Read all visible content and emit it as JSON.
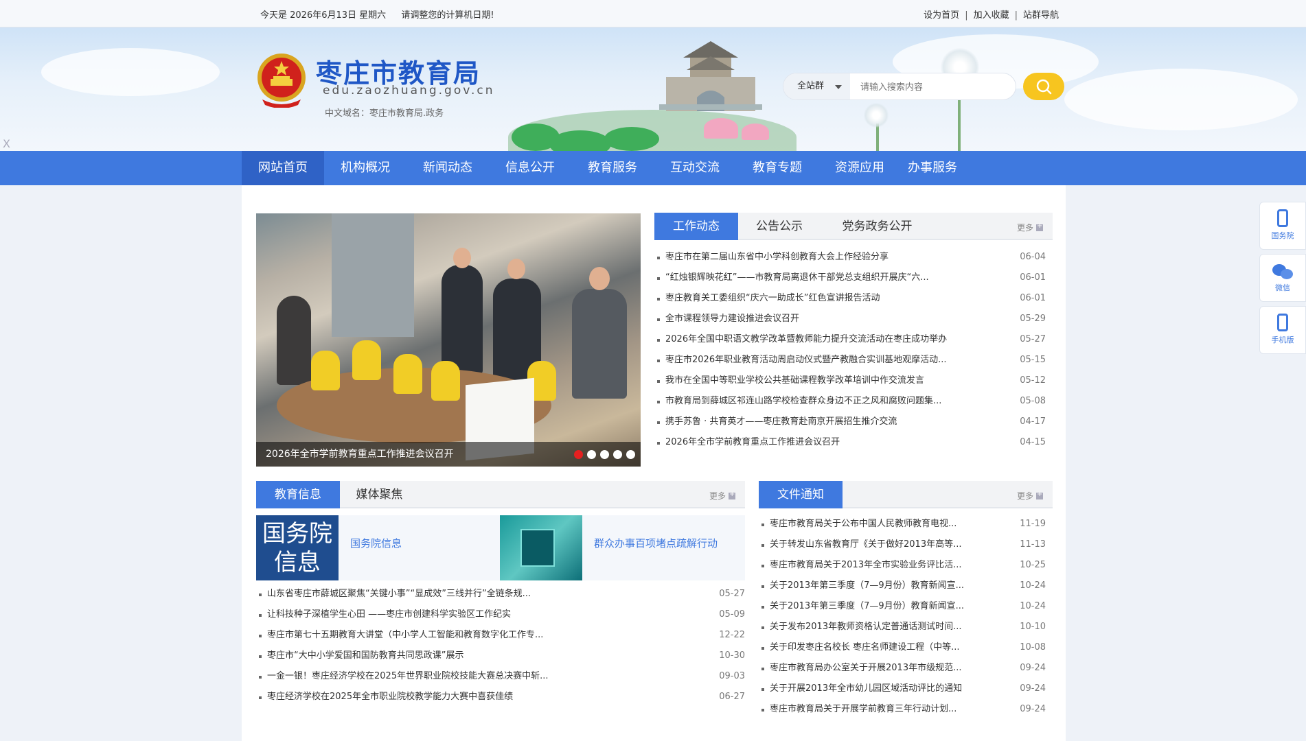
{
  "topbar": {
    "date_text": "今天是 2026年6月13日 星期六",
    "notice": "请调整您的计算机日期!",
    "links": [
      "设为首页",
      "加入收藏",
      "站群导航"
    ],
    "separator": "|"
  },
  "header": {
    "title": "枣庄市教育局",
    "domain": "edu.zaozhuang.gov.cn",
    "cn_domain": "中文域名：枣庄市教育局.政务",
    "close_mark": "X"
  },
  "search": {
    "scope": "全站群",
    "placeholder": "请输入搜索内容"
  },
  "nav": {
    "items": [
      "网站首页",
      "机构概况",
      "新闻动态",
      "信息公开",
      "教育服务",
      "互动交流",
      "教育专题",
      "资源应用",
      "办事服务"
    ],
    "active_index": 0
  },
  "slider": {
    "caption": "2026年全市学前教育重点工作推进会议召开",
    "dot_count": 5,
    "active_dot": 0
  },
  "work_box": {
    "tabs": [
      "工作动态",
      "公告公示",
      "党务政务公开"
    ],
    "more": "更多",
    "items": [
      {
        "title": "枣庄市在第二届山东省中小学科创教育大会上作经验分享",
        "date": "06-04"
      },
      {
        "title": "“红烛银辉映花红”——市教育局离退休干部党总支组织开展庆“六...",
        "date": "06-01"
      },
      {
        "title": "枣庄教育关工委组织“庆六一助成长”红色宣讲报告活动",
        "date": "06-01"
      },
      {
        "title": "全市课程领导力建设推进会议召开",
        "date": "05-29"
      },
      {
        "title": "2026年全国中职语文教学改革暨教师能力提升交流活动在枣庄成功举办",
        "date": "05-27"
      },
      {
        "title": "枣庄市2026年职业教育活动周启动仪式暨产教融合实训基地观摩活动...",
        "date": "05-15"
      },
      {
        "title": "我市在全国中等职业学校公共基础课程教学改革培训中作交流发言",
        "date": "05-12"
      },
      {
        "title": "市教育局到薛城区祁连山路学校检查群众身边不正之风和腐败问题集...",
        "date": "05-08"
      },
      {
        "title": "携手苏鲁 · 共育英才——枣庄教育赴南京开展招生推介交流",
        "date": "04-17"
      },
      {
        "title": "2026年全市学前教育重点工作推进会议召开",
        "date": "04-15"
      }
    ]
  },
  "edu_box": {
    "tabs": [
      "教育信息",
      "媒体聚焦"
    ],
    "more": "更多",
    "promos": [
      {
        "image_text_line1": "国务院",
        "image_text_line2": "信息",
        "label": "国务院信息"
      },
      {
        "label": "群众办事百项堵点疏解行动"
      }
    ],
    "items": [
      {
        "title": "山东省枣庄市薛城区聚焦“关键小事”“显成效”三线并行”全链条规...",
        "date": "05-27"
      },
      {
        "title": "让科技种子深植学生心田 ——枣庄市创建科学实验区工作纪实",
        "date": "05-09"
      },
      {
        "title": "枣庄市第七十五期教育大讲堂（中小学人工智能和教育数字化工作专...",
        "date": "12-22"
      },
      {
        "title": "枣庄市“大中小学爱国和国防教育共同思政课”展示",
        "date": "10-30"
      },
      {
        "title": "一金一银！枣庄经济学校在2025年世界职业院校技能大赛总决赛中斩...",
        "date": "09-03"
      },
      {
        "title": "枣庄经济学校在2025年全市职业院校教学能力大赛中喜获佳绩",
        "date": "06-27"
      }
    ]
  },
  "doc_box": {
    "tabs": [
      "文件通知"
    ],
    "more": "更多",
    "items": [
      {
        "title": "枣庄市教育局关于公布中国人民教师教育电视...",
        "date": "11-19"
      },
      {
        "title": "关于转发山东省教育厅《关于做好2013年高等...",
        "date": "11-13"
      },
      {
        "title": "枣庄市教育局关于2013年全市实验业务评比活...",
        "date": "10-25"
      },
      {
        "title": "关于2013年第三季度（7—9月份）教育新闻宣...",
        "date": "10-24"
      },
      {
        "title": "关于2013年第三季度（7—9月份）教育新闻宣...",
        "date": "10-24"
      },
      {
        "title": "关于发布2013年教师资格认定普通话测试时间...",
        "date": "10-10"
      },
      {
        "title": "关于印发枣庄名校长 枣庄名师建设工程（中等...",
        "date": "10-08"
      },
      {
        "title": "枣庄市教育局办公室关于开展2013年市级规范...",
        "date": "09-24"
      },
      {
        "title": "关于开展2013年全市幼儿园区域活动评比的通知",
        "date": "09-24"
      },
      {
        "title": "枣庄市教育局关于开展学前教育三年行动计划...",
        "date": "09-24"
      }
    ]
  },
  "float_bar": {
    "items": [
      {
        "label": "国务院",
        "icon": "phone-icon"
      },
      {
        "label": "微信",
        "icon": "wechat-icon"
      },
      {
        "label": "手机版",
        "icon": "mobile-icon"
      }
    ]
  },
  "colors": {
    "brand_blue": "#3f79df",
    "nav_active": "#2f62c6",
    "search_button": "#f7c51f",
    "slider_dot_active": "#e52020"
  }
}
